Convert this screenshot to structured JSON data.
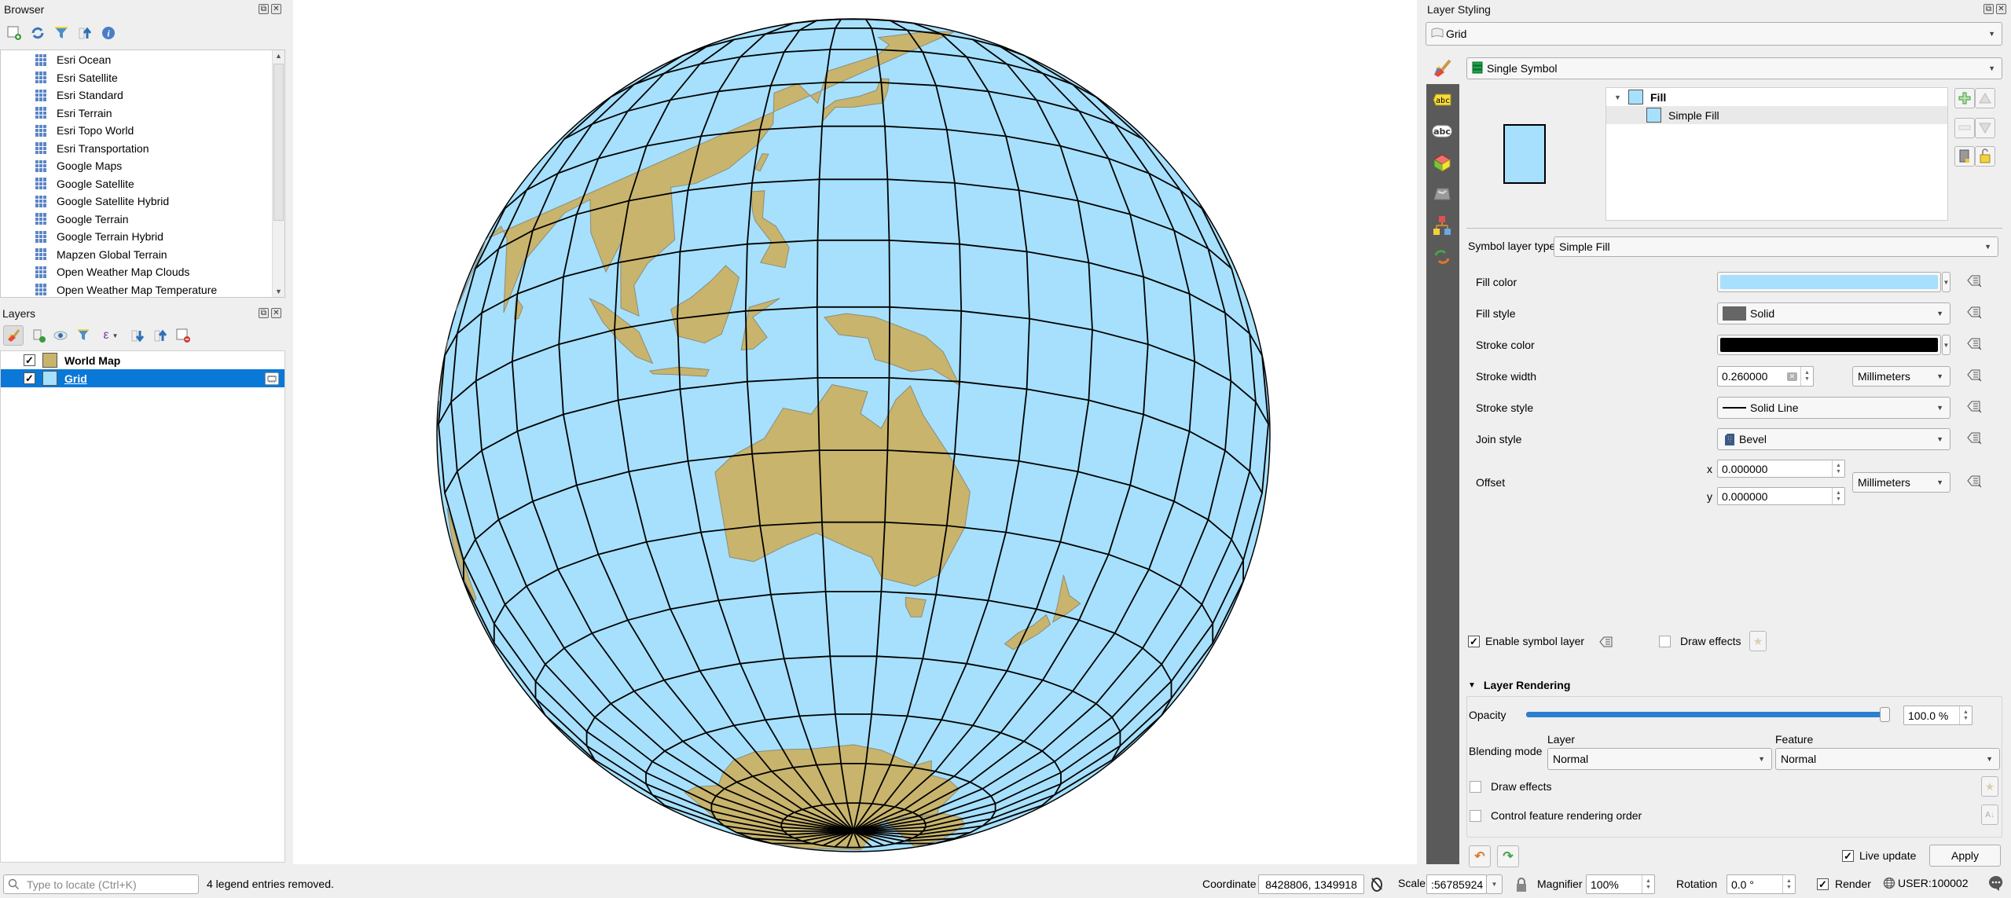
{
  "browser": {
    "title": "Browser",
    "toolbar": [
      "add-selected-layers",
      "refresh",
      "filter",
      "collapse-all",
      "properties"
    ],
    "items": [
      "Esri Ocean",
      "Esri Satellite",
      "Esri Standard",
      "Esri Terrain",
      "Esri Topo World",
      "Esri Transportation",
      "Google Maps",
      "Google Satellite",
      "Google Satellite Hybrid",
      "Google Terrain",
      "Google Terrain Hybrid",
      "Mapzen Global Terrain",
      "Open Weather Map Clouds",
      "Open Weather Map Temperature"
    ]
  },
  "layers": {
    "title": "Layers",
    "items": [
      {
        "name": "World Map",
        "checked": true,
        "color": "#c8b46c",
        "selected": false
      },
      {
        "name": "Grid",
        "checked": true,
        "color": "#a6e0fc",
        "selected": true
      }
    ]
  },
  "map": {
    "ocean_color": "#a6e0fc",
    "land_color": "#c8b46c",
    "grid_stroke": "#000000"
  },
  "styling": {
    "title": "Layer Styling",
    "layer_select": "Grid",
    "renderer": "Single Symbol",
    "tree": {
      "root": "Fill",
      "child": "Simple Fill"
    },
    "symbol_layer_type_label": "Symbol layer type",
    "symbol_layer_type": "Simple Fill",
    "fill_color_label": "Fill color",
    "fill_color": "#a6e0fc",
    "fill_style_label": "Fill style",
    "fill_style": "Solid",
    "stroke_color_label": "Stroke color",
    "stroke_color": "#000000",
    "stroke_width_label": "Stroke width",
    "stroke_width": "0.260000",
    "stroke_width_unit": "Millimeters",
    "stroke_style_label": "Stroke style",
    "stroke_style": "Solid Line",
    "join_style_label": "Join style",
    "join_style": "Bevel",
    "offset_label": "Offset",
    "offset_x_label": "x",
    "offset_x": "0.000000",
    "offset_y_label": "y",
    "offset_y": "0.000000",
    "offset_unit": "Millimeters",
    "enable_symbol_layer": "Enable symbol layer",
    "enable_symbol_layer_checked": true,
    "draw_effects": "Draw effects",
    "layer_rendering": "Layer Rendering",
    "opacity_label": "Opacity",
    "opacity_value": "100.0 %",
    "opacity_fraction": 1.0,
    "blending_label": "Blending mode",
    "blend_layer_label": "Layer",
    "blend_layer": "Normal",
    "blend_feature_label": "Feature",
    "blend_feature": "Normal",
    "render_draw_effects": "Draw effects",
    "control_order": "Control feature rendering order",
    "live_update": "Live update",
    "live_update_checked": true,
    "apply": "Apply"
  },
  "statusbar": {
    "locate_placeholder": "Type to locate (Ctrl+K)",
    "message": "4 legend entries removed.",
    "coordinate_label": "Coordinate",
    "coordinate": "8428806, 1349918",
    "scale_label": "Scale",
    "scale": ":56785924",
    "magnifier_label": "Magnifier",
    "magnifier": "100%",
    "rotation_label": "Rotation",
    "rotation": "0.0 °",
    "render_label": "Render",
    "render_checked": true,
    "crs": "USER:100002"
  }
}
